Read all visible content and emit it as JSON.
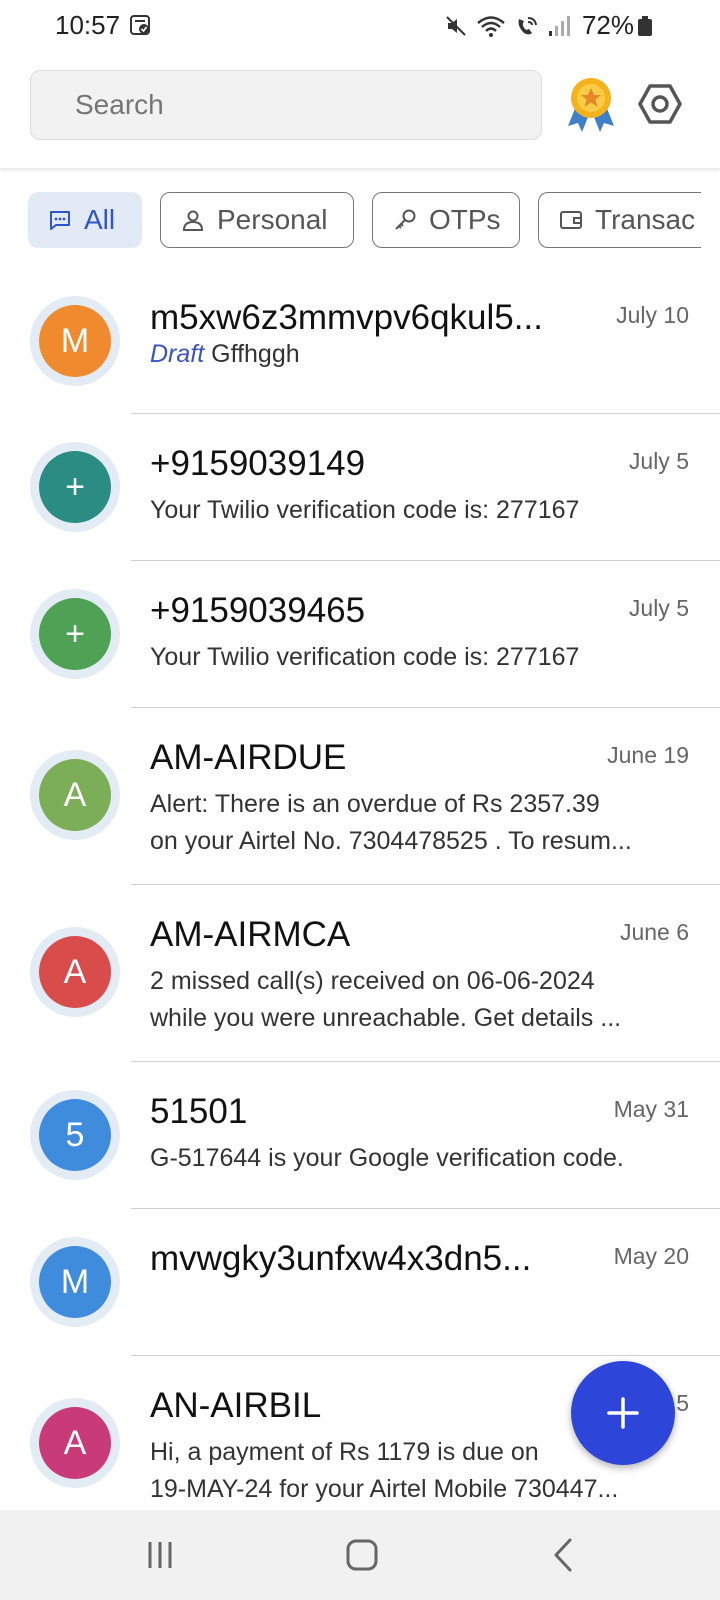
{
  "status_bar": {
    "time": "10:57",
    "battery": "72%",
    "icons": [
      "calendar-check-icon",
      "mute-icon",
      "wifi-icon",
      "wifi-calling-icon",
      "signal-icon",
      "battery-icon"
    ]
  },
  "search": {
    "placeholder": "Search",
    "value": ""
  },
  "header_icons": [
    "premium-badge-icon",
    "settings-icon"
  ],
  "chips": [
    {
      "label": "All",
      "icon": "message-icon",
      "active": true
    },
    {
      "label": "Personal",
      "icon": "person-icon",
      "active": false
    },
    {
      "label": "OTPs",
      "icon": "key-icon",
      "active": false
    },
    {
      "label": "Transac",
      "icon": "wallet-icon",
      "active": false
    }
  ],
  "conversations": [
    {
      "name": "m5xw6z3mmvpv6qkul5...",
      "date": "July 10",
      "draft_label": "Draft",
      "snippet_line1": "Gffhggh",
      "snippet_line2": "",
      "initial": "M",
      "color": "#ef8a2e"
    },
    {
      "name": "+9159039149",
      "date": "July 5",
      "draft_label": "",
      "snippet_line1": "Your Twilio verification code is: 277167",
      "snippet_line2": "",
      "initial": "+",
      "color": "#2a8c82"
    },
    {
      "name": "+9159039465",
      "date": "July 5",
      "draft_label": "",
      "snippet_line1": "Your Twilio verification code is: 277167",
      "snippet_line2": "",
      "initial": "+",
      "color": "#4fa155"
    },
    {
      "name": "AM-AIRDUE",
      "date": "June 19",
      "draft_label": "",
      "snippet_line1": "Alert: There is an overdue of Rs 2357.39",
      "snippet_line2": "on your Airtel No. 7304478525 . To resum...",
      "initial": "A",
      "color": "#7cad57"
    },
    {
      "name": "AM-AIRMCA",
      "date": "June 6",
      "draft_label": "",
      "snippet_line1": "2 missed call(s) received on 06-06-2024",
      "snippet_line2": "while you were unreachable. Get details ...",
      "initial": "A",
      "color": "#d94c4c"
    },
    {
      "name": "51501",
      "date": "May 31",
      "draft_label": "",
      "snippet_line1": "G-517644 is your Google verification code.",
      "snippet_line2": "",
      "initial": "5",
      "color": "#3f8bdc"
    },
    {
      "name": "mvwgky3unfxw4x3dn5...",
      "date": "May 20",
      "draft_label": "",
      "snippet_line1": "",
      "snippet_line2": "",
      "initial": "M",
      "color": "#3f8bdc"
    },
    {
      "name": "AN-AIRBIL",
      "date": "5",
      "draft_label": "",
      "snippet_line1": "Hi, a payment of Rs 1179 is due on",
      "snippet_line2": "19-MAY-24 for your Airtel Mobile 730447...",
      "initial": "A",
      "color": "#c83a78"
    }
  ],
  "fab": {
    "icon": "plus-icon"
  },
  "nav": [
    "recents-icon",
    "home-icon",
    "back-icon"
  ]
}
